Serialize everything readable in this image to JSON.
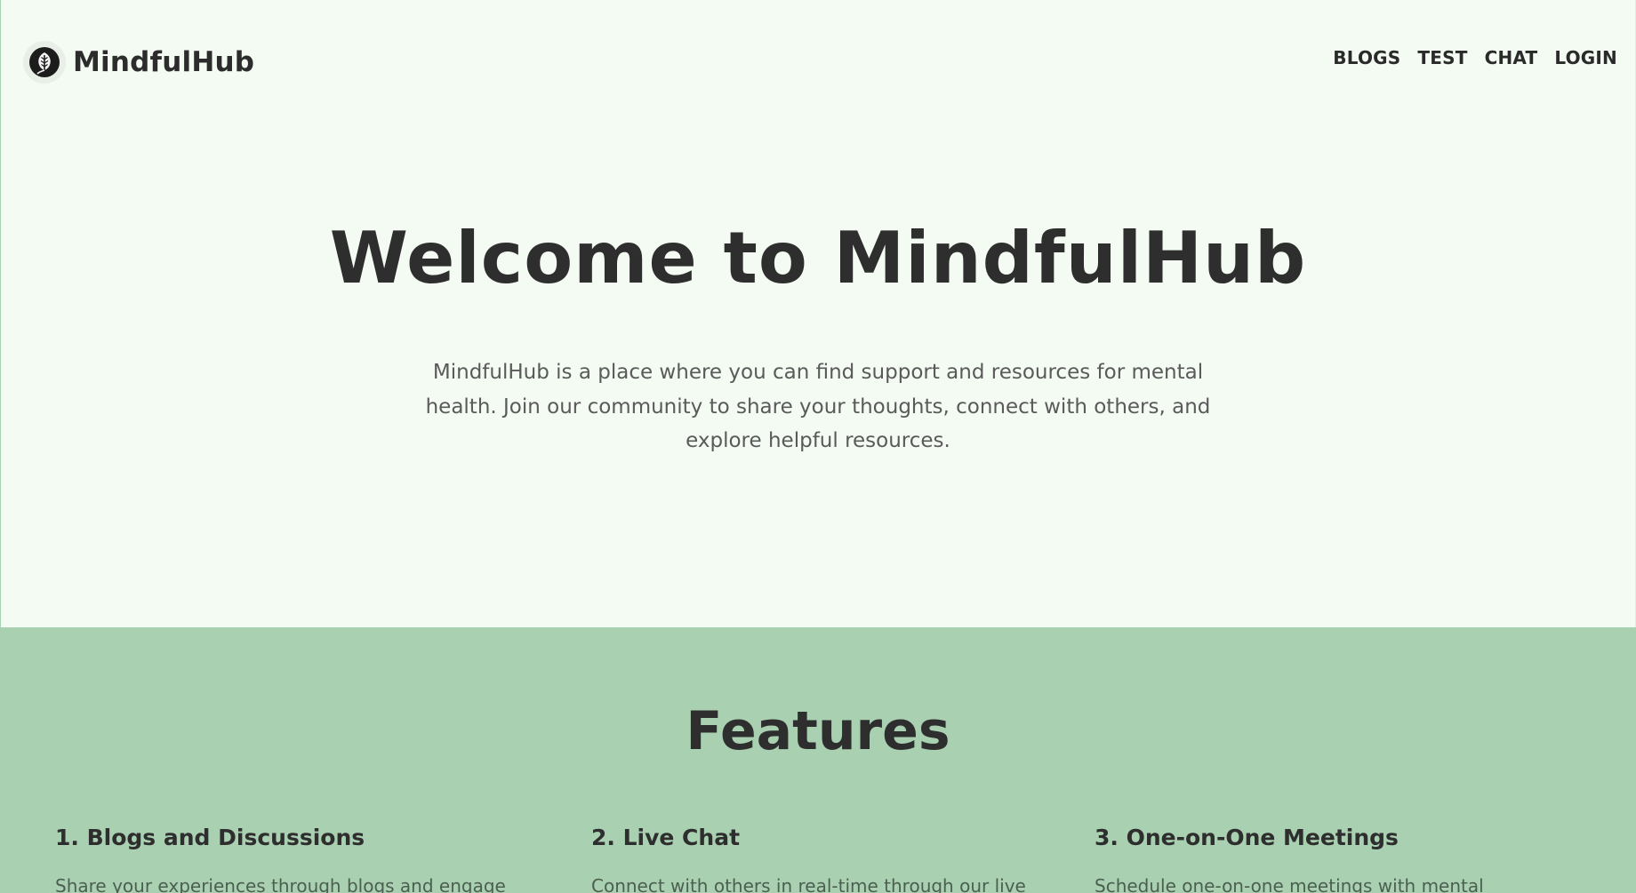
{
  "brand": {
    "name": "MindfulHub",
    "logo_icon": "leaf-icon"
  },
  "nav": {
    "items": [
      "BLOGS",
      "TEST",
      "CHAT",
      "LOGIN"
    ]
  },
  "hero": {
    "title": "Welcome to MindfulHub",
    "subtitle": "MindfulHub is a place where you can find support and resources for mental health. Join our community to share your thoughts, connect with others, and explore helpful resources."
  },
  "features": {
    "title": "Features",
    "items": [
      {
        "title": "1. Blogs and Discussions",
        "description": "Share your experiences through blogs and engage"
      },
      {
        "title": "2. Live Chat",
        "description": "Connect with others in real-time through our live"
      },
      {
        "title": "3. One-on-One Meetings",
        "description": "Schedule one-on-one meetings with mental"
      }
    ]
  },
  "colors": {
    "page_background": "#f3fbf3",
    "features_background": "#a9d0b1",
    "text_dark": "#2e2e2e",
    "text_muted": "#5a5a5a"
  }
}
